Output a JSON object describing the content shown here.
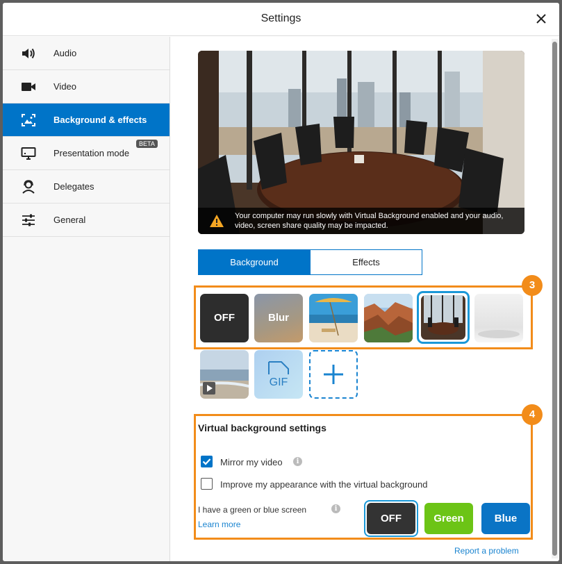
{
  "dialog": {
    "title": "Settings"
  },
  "sidebar": {
    "items": [
      {
        "label": "Audio",
        "icon": "speaker-icon",
        "active": false
      },
      {
        "label": "Video",
        "icon": "video-camera-icon",
        "active": false
      },
      {
        "label": "Background & effects",
        "icon": "background-icon",
        "active": true
      },
      {
        "label": "Presentation mode",
        "icon": "monitor-icon",
        "active": false,
        "badge": "BETA"
      },
      {
        "label": "Delegates",
        "icon": "person-headset-icon",
        "active": false
      },
      {
        "label": "General",
        "icon": "sliders-icon",
        "active": false
      }
    ]
  },
  "preview": {
    "warning": "Your computer may run slowly with Virtual Background enabled and your audio, video, screen share quality may be impacted."
  },
  "tabs": [
    {
      "label": "Background",
      "active": true
    },
    {
      "label": "Effects",
      "active": false
    }
  ],
  "backgrounds": {
    "items": [
      {
        "label": "OFF",
        "kind": "off"
      },
      {
        "label": "Blur",
        "kind": "blur"
      },
      {
        "label": "",
        "kind": "beach-image"
      },
      {
        "label": "",
        "kind": "canyon-image"
      },
      {
        "label": "",
        "kind": "conference-room-image",
        "selected": true
      },
      {
        "label": "",
        "kind": "white-room-image"
      },
      {
        "label": "",
        "kind": "beach-video"
      },
      {
        "label": "GIF",
        "kind": "gif"
      },
      {
        "label": "",
        "kind": "add"
      }
    ],
    "highlight_badge": "3"
  },
  "vb_settings": {
    "title": "Virtual background settings",
    "highlight_badge": "4",
    "mirror_label": "Mirror my video",
    "mirror_checked": true,
    "improve_label": "Improve my appearance with the virtual background",
    "improve_checked": false,
    "screen_label": "I have a green or blue screen",
    "learn_more": "Learn more",
    "screen_options": [
      {
        "label": "OFF",
        "color": "#333333",
        "selected": true
      },
      {
        "label": "Green",
        "color": "#6cc416",
        "selected": false
      },
      {
        "label": "Blue",
        "color": "#0a74c5",
        "selected": false
      }
    ]
  },
  "footer": {
    "report_link": "Report a problem"
  },
  "colors": {
    "accent": "#0074c8",
    "highlight": "#f28c1a",
    "warning": "#f5a623"
  }
}
